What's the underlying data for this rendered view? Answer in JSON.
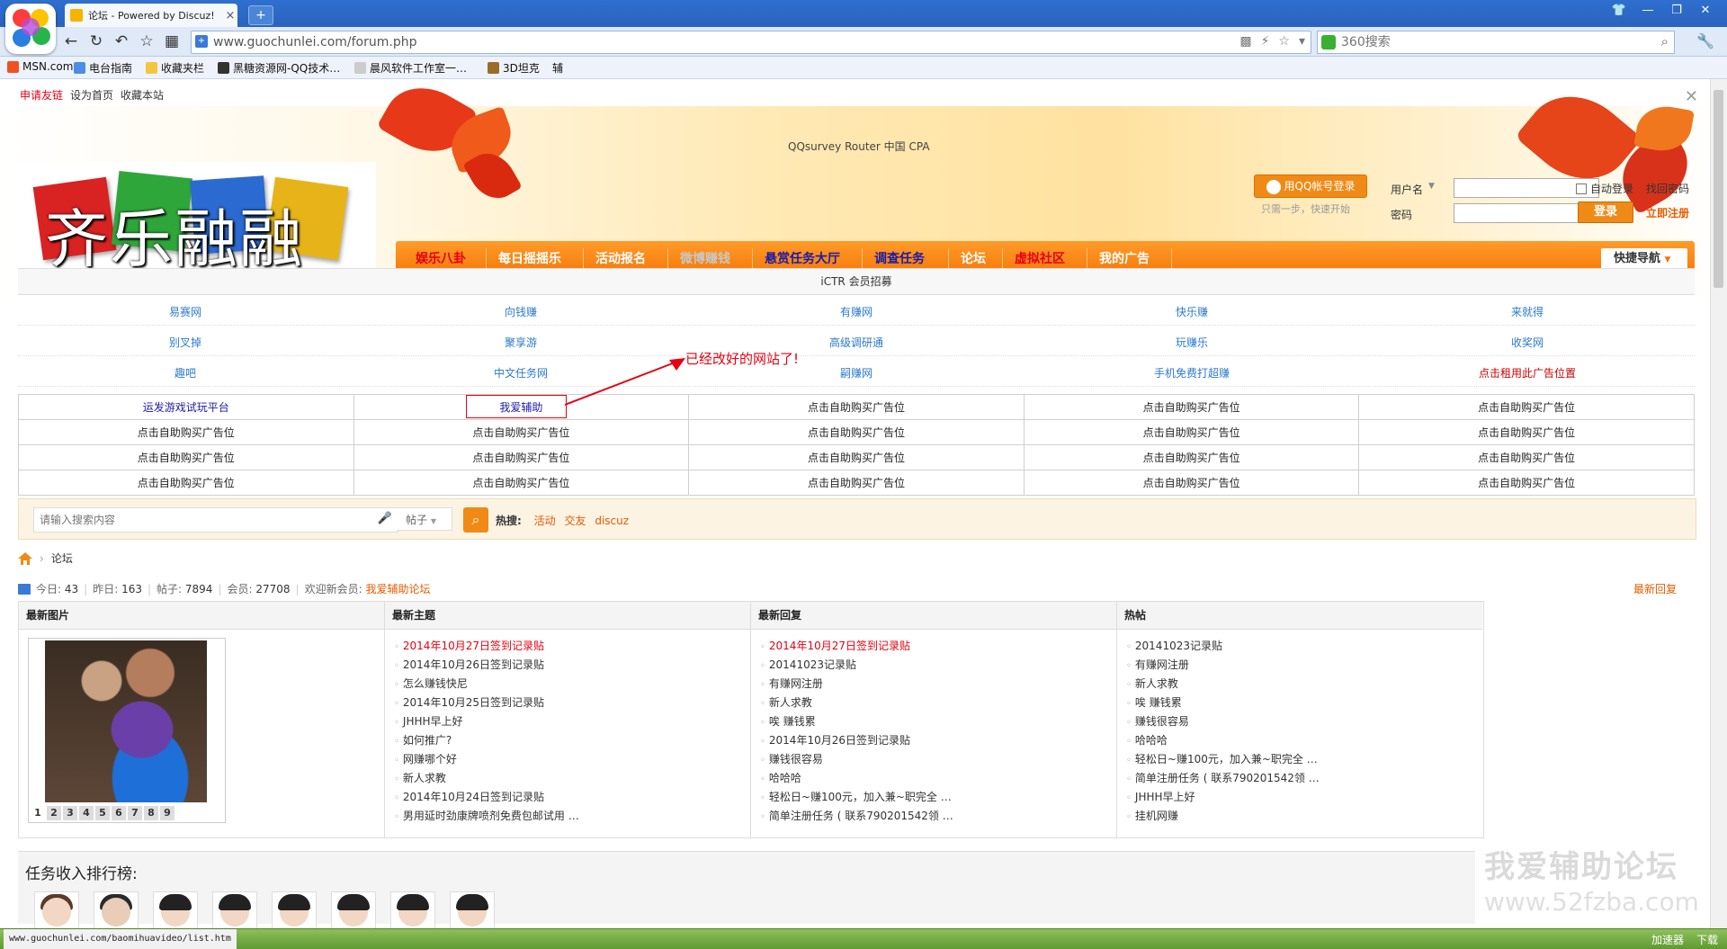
{
  "browser": {
    "tab_title": "论坛 - Powered by Discuz!",
    "url": "www.guochunlei.com/forum.php",
    "search_placeholder": "360搜索",
    "bookmarks": [
      "MSN.com",
      "电台指南",
      "收藏夹栏",
      "黑糖资源网-QQ技术…",
      "晨风软件工作室一…",
      "3D坦克",
      "辅"
    ],
    "status_url": "www.guochunlei.com/baomihuavideo/list.htm",
    "status_right": [
      "加速器",
      "下载"
    ]
  },
  "topbar": {
    "apply_link": "申请友链",
    "set_home": "设为首页",
    "bookmark": "收藏本站"
  },
  "banner": {
    "router_text": "QQsurvey Router 中国 CPA",
    "logo_text": "齐乐融融"
  },
  "login": {
    "qq_button": "用QQ帐号登录",
    "qq_sub": "只需一步，快速开始",
    "username_label": "用户名",
    "password_label": "密码",
    "remember": "自动登录",
    "forgot": "找回密码",
    "login_button": "登录",
    "register": "立即注册"
  },
  "mainnav": {
    "items": [
      "娱乐八卦",
      "每日摇摇乐",
      "活动报名",
      "微博赚钱",
      "悬赏任务大厅",
      "调查任务",
      "论坛",
      "虚拟社区",
      "我的广告"
    ],
    "quick_nav": "快捷导航"
  },
  "iclr_title": "iCTR 会员招募",
  "link_rows": [
    [
      "易赛网",
      "向钱赚",
      "有赚网",
      "快乐赚",
      "来就得"
    ],
    [
      "别叉掉",
      "聚享游",
      "高级调研通",
      "玩赚乐",
      "收奖网"
    ],
    [
      "趣吧",
      "中文任务网",
      "嗣赚网",
      "手机免费打超赚",
      "点击租用此广告位置"
    ]
  ],
  "annotation": "已经改好的网站了!",
  "ad_rows": [
    [
      "运发游戏试玩平台",
      "我爱辅助",
      "点击自助购买广告位",
      "点击自助购买广告位",
      "点击自助购买广告位"
    ],
    [
      "点击自助购买广告位",
      "点击自助购买广告位",
      "点击自助购买广告位",
      "点击自助购买广告位",
      "点击自助购买广告位"
    ],
    [
      "点击自助购买广告位",
      "点击自助购买广告位",
      "点击自助购买广告位",
      "点击自助购买广告位",
      "点击自助购买广告位"
    ],
    [
      "点击自助购买广告位",
      "点击自助购买广告位",
      "点击自助购买广告位",
      "点击自助购买广告位",
      "点击自助购买广告位"
    ]
  ],
  "search": {
    "placeholder": "请输入搜索内容",
    "type": "帖子",
    "hot_label": "热搜:",
    "hot": [
      "活动",
      "交友",
      "discuz"
    ]
  },
  "breadcrumb": "论坛",
  "stats": {
    "today_label": "今日:",
    "today": "43",
    "yesterday_label": "昨日:",
    "yesterday": "163",
    "posts_label": "帖子:",
    "posts": "7894",
    "members_label": "会员:",
    "members": "27708",
    "welcome": "欢迎新会员:",
    "new_member": "我爱辅助论坛",
    "latest_reply": "最新回复"
  },
  "portal": {
    "col1_title": "最新图片",
    "col2_title": "最新主题",
    "col3_title": "最新回复",
    "col4_title": "热帖",
    "pager": [
      "1",
      "2",
      "3",
      "4",
      "5",
      "6",
      "7",
      "8",
      "9"
    ],
    "latest_topics": [
      "2014年10月27日签到记录贴",
      "2014年10月26日签到记录贴",
      "怎么赚钱快尼",
      "2014年10月25日签到记录贴",
      "JHHH早上好",
      "如何推广?",
      "网赚哪个好",
      "新人求教",
      "2014年10月24日签到记录贴",
      "男用延时劲康牌喷剂免费包邮试用 …"
    ],
    "latest_replies": [
      "2014年10月27日签到记录贴",
      "20141023记录贴",
      "有赚网注册",
      "新人求教",
      "唉 赚钱累",
      "2014年10月26日签到记录贴",
      "赚钱很容易",
      "哈哈哈",
      "轻松日~赚100元，加入兼~职完全 …",
      "简单注册任务 ( 联系790201542领 …"
    ],
    "hot_posts": [
      "20141023记录贴",
      "有赚网注册",
      "新人求教",
      "唉 赚钱累",
      "赚钱很容易",
      "哈哈哈",
      "轻松日~赚100元，加入兼~职完全 …",
      "简单注册任务 ( 联系790201542领 …",
      "JHHH早上好",
      "挂机网赚"
    ]
  },
  "rank_title": "任务收入排行榜:",
  "watermark": {
    "line1": "我爱辅助论坛",
    "line2": "www.52fzba.com"
  }
}
